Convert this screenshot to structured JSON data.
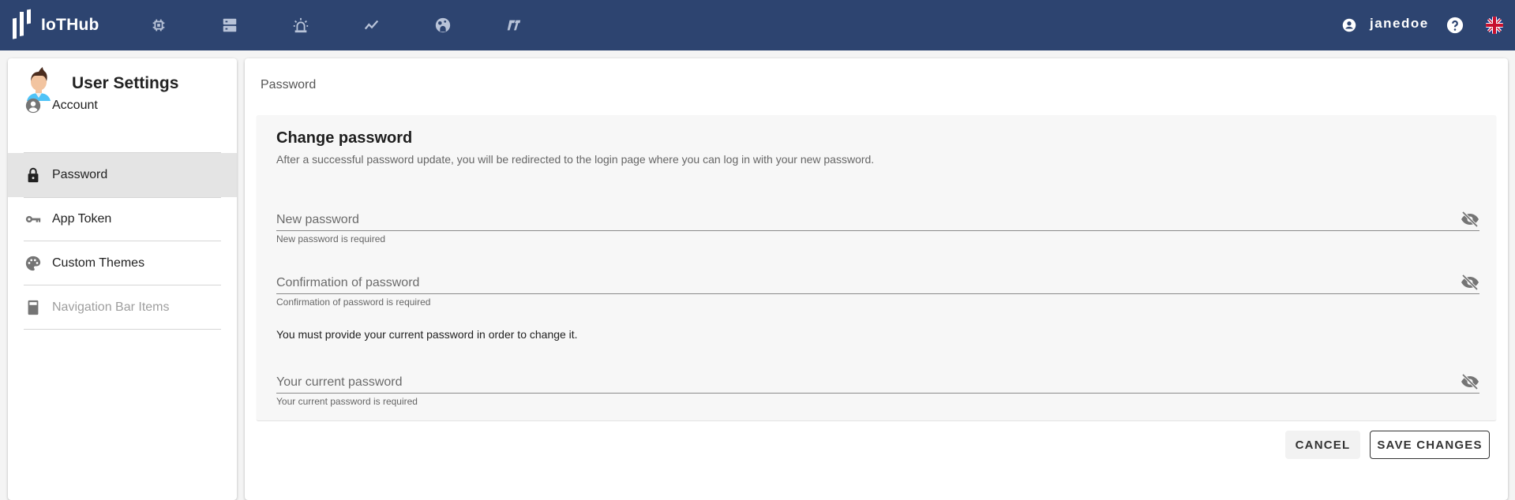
{
  "app": {
    "name": "IoTHub",
    "brand_color": "#2d4470"
  },
  "topbar": {
    "nav_icons": [
      {
        "name": "devices-chip-icon"
      },
      {
        "name": "servers-icon"
      },
      {
        "name": "alarm-icon"
      },
      {
        "name": "analytics-icon"
      },
      {
        "name": "dashboard-icon"
      },
      {
        "name": "integration-icon"
      }
    ],
    "username": "janedoe",
    "language": "en-GB"
  },
  "sidebar": {
    "title": "User Settings",
    "items": [
      {
        "label": "Account",
        "icon": "account-circle-icon",
        "active": false,
        "disabled": false
      },
      {
        "label": "Password",
        "icon": "lock-icon",
        "active": true,
        "disabled": false
      },
      {
        "label": "App Token",
        "icon": "key-icon",
        "active": false,
        "disabled": false
      },
      {
        "label": "Custom Themes",
        "icon": "palette-icon",
        "active": false,
        "disabled": false
      },
      {
        "label": "Navigation Bar Items",
        "icon": "calculator-icon",
        "active": false,
        "disabled": true
      }
    ]
  },
  "main": {
    "breadcrumb": "Password",
    "card": {
      "title": "Change password",
      "description": "After a successful password update, you will be redirected to the login page where you can log in with your new password.",
      "fields": [
        {
          "label": "New password",
          "value": "",
          "helper": "New password is required"
        },
        {
          "label": "Confirmation of password",
          "value": "",
          "helper": "Confirmation of password is required"
        },
        {
          "label": "Your current password",
          "value": "",
          "helper": "Your current password is required"
        }
      ],
      "notice": "You must provide your current password in order to change it."
    },
    "buttons": {
      "cancel": "CANCEL",
      "save": "SAVE CHANGES"
    }
  }
}
